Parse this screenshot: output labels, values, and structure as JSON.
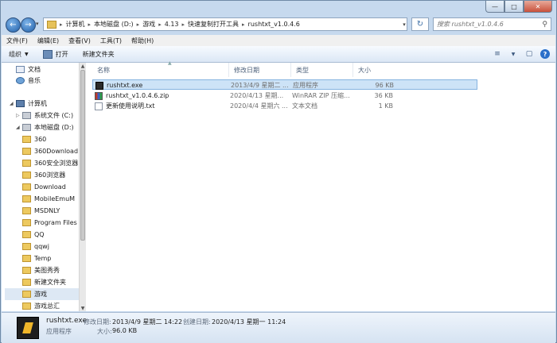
{
  "address": {
    "crumbs": [
      "计算机",
      "本地磁盘 (D:)",
      "游戏",
      "4.13",
      "快速复制打开工具",
      "rushtxt_v1.0.4.6"
    ],
    "search_placeholder": "搜索 rushtxt_v1.0.4.6"
  },
  "menu": [
    "文件(F)",
    "编辑(E)",
    "查看(V)",
    "工具(T)",
    "帮助(H)"
  ],
  "toolbar": {
    "organize": "组织",
    "open": "打开",
    "new_folder": "新建文件夹"
  },
  "nav": {
    "items": [
      {
        "label": "文档",
        "icon": "document-icon"
      },
      {
        "label": "音乐",
        "icon": "music-icon"
      },
      {
        "label": "计算机",
        "icon": "computer-icon"
      },
      {
        "label": "系统文件 (C:)",
        "icon": "drive-icon"
      },
      {
        "label": "本地磁盘 (D:)",
        "icon": "drive-icon"
      },
      {
        "label": "360",
        "icon": "folder-icon"
      },
      {
        "label": "360Download",
        "icon": "folder-icon"
      },
      {
        "label": "360安全浏览器",
        "icon": "folder-icon"
      },
      {
        "label": "360浏览器",
        "icon": "folder-icon"
      },
      {
        "label": "Download",
        "icon": "folder-icon"
      },
      {
        "label": "MobileEmuM",
        "icon": "folder-icon"
      },
      {
        "label": "MSDNLY",
        "icon": "folder-icon"
      },
      {
        "label": "Program Files",
        "icon": "folder-icon"
      },
      {
        "label": "QQ",
        "icon": "folder-icon"
      },
      {
        "label": "qqwj",
        "icon": "folder-icon"
      },
      {
        "label": "Temp",
        "icon": "folder-icon"
      },
      {
        "label": "美图秀秀",
        "icon": "folder-icon"
      },
      {
        "label": "新建文件夹",
        "icon": "folder-icon"
      },
      {
        "label": "游戏",
        "icon": "folder-icon"
      },
      {
        "label": "游戏总汇",
        "icon": "folder-icon"
      }
    ]
  },
  "columns": {
    "name": "名称",
    "date": "修改日期",
    "type": "类型",
    "size": "大小"
  },
  "files": [
    {
      "name": "rushtxt.exe",
      "date": "2013/4/9 星期二 ...",
      "type": "应用程序",
      "size": "96 KB"
    },
    {
      "name": "rushtxt_v1.0.4.6.zip",
      "date": "2020/4/13 星期...",
      "type": "WinRAR ZIP 压缩...",
      "size": "36 KB"
    },
    {
      "name": "更新使用说明.txt",
      "date": "2020/4/4 星期六 ...",
      "type": "文本文档",
      "size": "1 KB"
    }
  ],
  "details": {
    "name": "rushtxt.exe",
    "type": "应用程序",
    "modified_label": "修改日期:",
    "modified_value": "2013/4/9 星期二 14:22",
    "created_label": "创建日期:",
    "created_value": "2020/4/13 星期一 11:24",
    "size_label": "大小:",
    "size_value": "96.0 KB"
  },
  "colors": {
    "selection": "#cde3f7",
    "toolbar": "#dbe7f5",
    "frame": "#c6d9ee"
  }
}
